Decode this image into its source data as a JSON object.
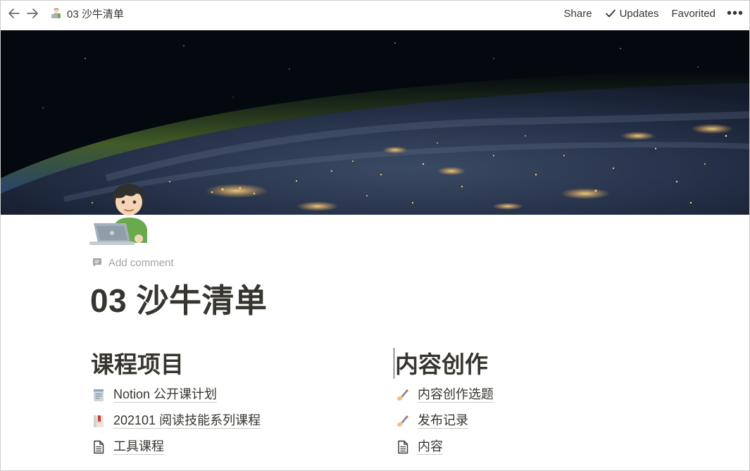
{
  "topbar": {
    "breadcrumb_title": "03 沙牛清单",
    "share_label": "Share",
    "updates_label": "Updates",
    "favorited_label": "Favorited",
    "more_label": "•••"
  },
  "page": {
    "add_comment_label": "Add comment",
    "title": "03 沙牛清单"
  },
  "columns": {
    "left": {
      "heading": "课程项目",
      "items": [
        {
          "label": "Notion 公开课计划",
          "icon": "notepad-icon"
        },
        {
          "label": "202101 阅读技能系列课程",
          "icon": "bookmark-icon"
        },
        {
          "label": "工具课程",
          "icon": "page-icon"
        }
      ]
    },
    "right": {
      "heading": "内容创作",
      "items": [
        {
          "label": "内容创作选题",
          "icon": "writing-hand-icon"
        },
        {
          "label": "发布记录",
          "icon": "writing-hand-icon"
        },
        {
          "label": "内容",
          "icon": "page-icon"
        }
      ]
    }
  },
  "colors": {
    "text": "#37352f",
    "muted": "#a4a3a0",
    "space": "#050a12"
  }
}
